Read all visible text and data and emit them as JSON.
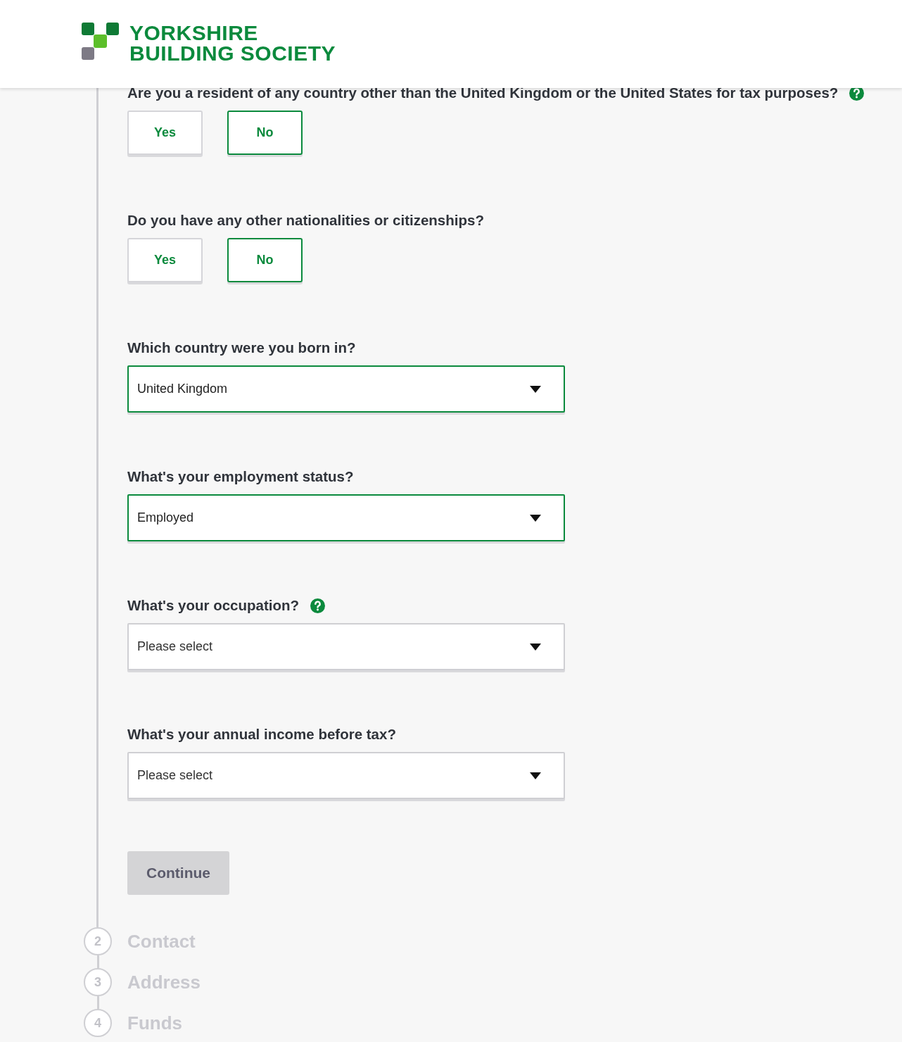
{
  "header": {
    "logo_line_1": "YORKSHIRE",
    "logo_line_2": "BUILDING SOCIETY"
  },
  "questions": [
    {
      "kind": "choice",
      "label": "Are you a resident of any country other than the United Kingdom or the United States for tax purposes?",
      "help": true,
      "options": [
        {
          "label": "Yes",
          "selected": false
        },
        {
          "label": "No",
          "selected": true
        }
      ]
    },
    {
      "kind": "choice",
      "label": "Do you have any other nationalities or citizenships?",
      "help": false,
      "options": [
        {
          "label": "Yes",
          "selected": false
        },
        {
          "label": "No",
          "selected": true
        }
      ]
    },
    {
      "kind": "select",
      "label": "Which country were you born in?",
      "help": false,
      "value": "United Kingdom"
    },
    {
      "kind": "select",
      "label": "What's your employment status?",
      "help": false,
      "value": "Employed"
    },
    {
      "kind": "select",
      "label": "What's your occupation?",
      "help": true,
      "placeholder": "Please select"
    },
    {
      "kind": "select",
      "label": "What's your annual income before tax?",
      "help": false,
      "placeholder": "Please select"
    }
  ],
  "continue_button": {
    "label": "Continue",
    "disabled": true
  },
  "steps": [
    {
      "number": "2",
      "label": "Contact"
    },
    {
      "number": "3",
      "label": "Address"
    },
    {
      "number": "4",
      "label": "Funds"
    }
  ]
}
